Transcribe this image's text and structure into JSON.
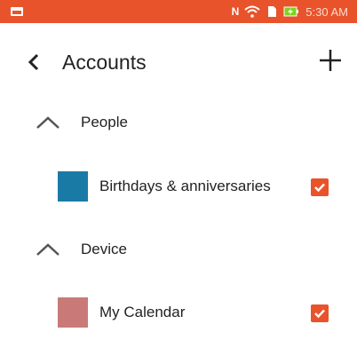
{
  "status_bar": {
    "background": "#e8532b",
    "icons": [
      "notification-icon",
      "nfc-icon",
      "wifi-icon",
      "sim-icon",
      "battery-charging-icon"
    ],
    "nfc_text": "N",
    "time": "5:30 AM"
  },
  "toolbar": {
    "back_icon": "chevron-left-icon",
    "title": "Accounts",
    "add_icon": "plus-icon"
  },
  "sections": [
    {
      "label": "People",
      "expanded": true,
      "accounts": [
        {
          "label": "Birthdays & anniversaries",
          "color": "#1a7aa6",
          "checked": true
        }
      ]
    },
    {
      "label": "Device",
      "expanded": true,
      "accounts": [
        {
          "label": "My Calendar",
          "color": "#c97a78",
          "checked": true
        }
      ]
    }
  ],
  "checkbox_color": "#e8532b"
}
